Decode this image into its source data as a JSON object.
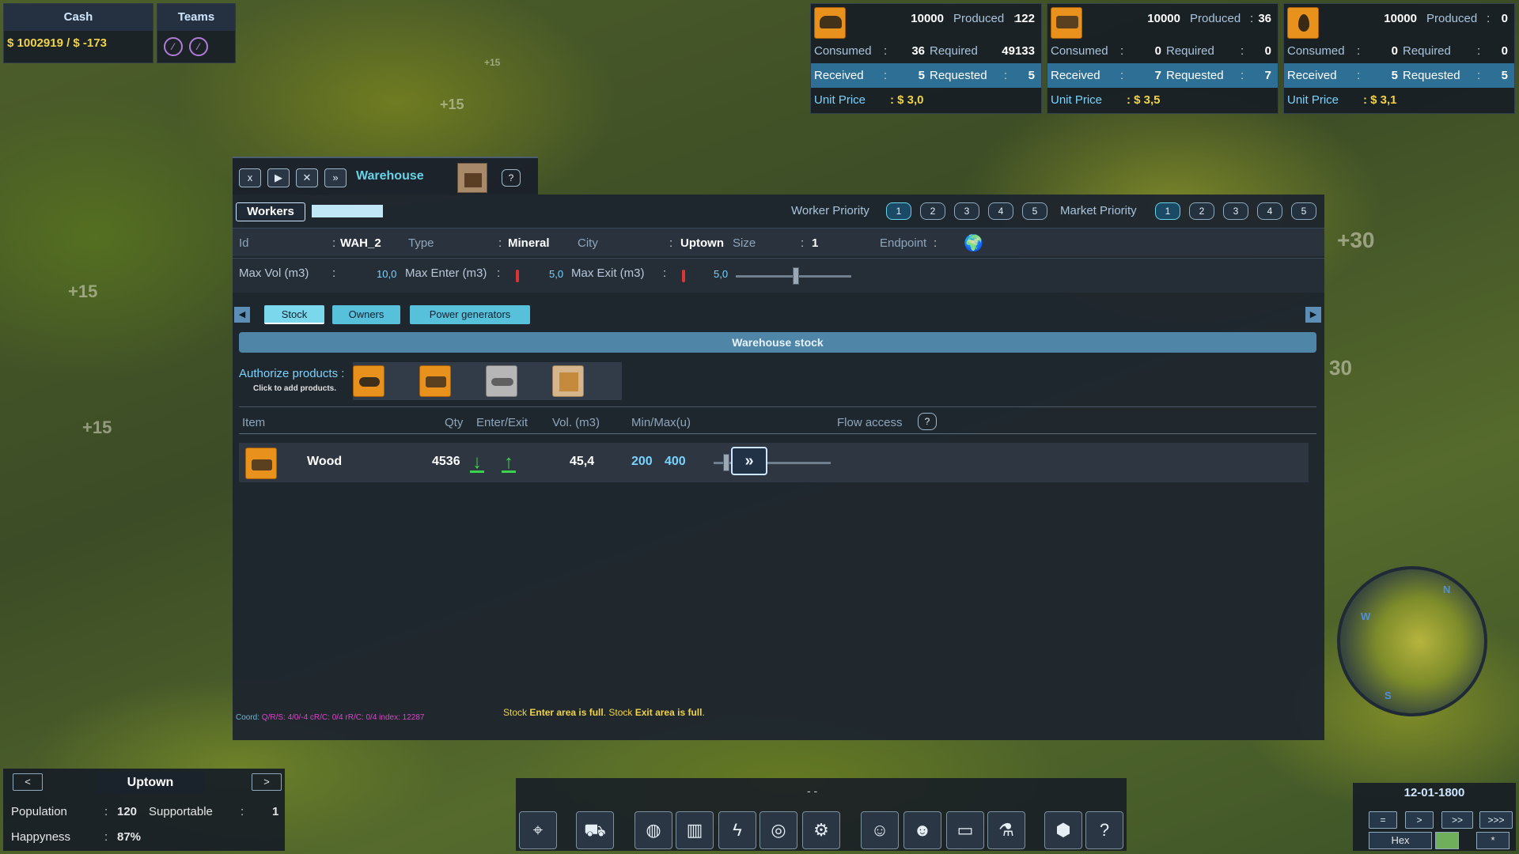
{
  "top_left": {
    "cash_label": "Cash",
    "cash_value": "$ 1002919  /  $ -173",
    "teams_label": "Teams"
  },
  "resources": [
    {
      "icon": "tools-icon",
      "amount": "10000",
      "produced_label": "Produced",
      "produced": "122",
      "consumed_label": "Consumed",
      "consumed": "36",
      "required_label": "Required",
      "required": "49133",
      "received_label": "Received",
      "received": "5",
      "requested_label": "Requested",
      "requested": "5",
      "unit_price_label": "Unit Price",
      "unit_price": ": $ 3,0"
    },
    {
      "icon": "wood-icon",
      "amount": "10000",
      "produced_label": "Produced",
      "produced": "36",
      "consumed_label": "Consumed",
      "consumed": "0",
      "required_label": "Required",
      "required": "0",
      "received_label": "Received",
      "received": "7",
      "requested_label": "Requested",
      "requested": "7",
      "unit_price_label": "Unit Price",
      "unit_price": ": $ 3,5"
    },
    {
      "icon": "oil-drop-icon",
      "amount": "10000",
      "produced_label": "Produced",
      "produced": "0",
      "consumed_label": "Consumed",
      "consumed": "0",
      "required_label": "Required",
      "required": "0",
      "received_label": "Received",
      "received": "5",
      "requested_label": "Requested",
      "requested": "5",
      "unit_price_label": "Unit Price",
      "unit_price": ": $ 3,1"
    }
  ],
  "window": {
    "title": "Warehouse",
    "close_glyph": "x",
    "play_glyph": "▶",
    "cross_glyph": "✕",
    "ff_glyph": "»",
    "help_glyph": "?"
  },
  "workers": {
    "button_label": "Workers",
    "worker_priority_label": "Worker Priority",
    "market_priority_label": "Market Priority",
    "priorities": [
      "1",
      "2",
      "3",
      "4",
      "5"
    ]
  },
  "info": {
    "id_label": "Id",
    "id_value": "WAH_2",
    "type_label": "Type",
    "type_value": "Mineral",
    "city_label": "City",
    "city_value": "Uptown",
    "size_label": "Size",
    "size_value": "1",
    "endpoint_label": "Endpoint",
    "max_vol_label": "Max Vol (m3)",
    "max_vol_value": "10,0",
    "max_enter_label": "Max Enter (m3)",
    "max_enter_value": "5,0",
    "max_exit_label": "Max Exit (m3)",
    "max_exit_value": "5,0"
  },
  "tabs": [
    "Stock",
    "Owners",
    "Power generators"
  ],
  "stock": {
    "header": "Warehouse stock",
    "authorize_label": "Authorize products :",
    "authorize_hint": "Click to add products.",
    "columns": {
      "item": "Item",
      "qty": "Qty",
      "enter_exit": "Enter/Exit",
      "vol": "Vol. (m3)",
      "minmax": "Min/Max(u)",
      "flow": "Flow access"
    },
    "rows": [
      {
        "item": "Wood",
        "qty": "4536",
        "vol": "45,4",
        "min": "200",
        "max": "400"
      }
    ]
  },
  "footer": {
    "coord_label": "Coord:",
    "coord_value": "Q/R/S: 4/0/-4 cR/C: 0/4 rR/C: 0/4 index: 12287",
    "status_1": "Stock ",
    "status_2": "Enter area is full",
    "status_3": ". Stock ",
    "status_4": "Exit area is full",
    "status_5": "."
  },
  "city": {
    "prev": "<",
    "next": ">",
    "name": "Uptown",
    "population_label": "Population",
    "population": "120",
    "supportable_label": "Supportable",
    "supportable": "1",
    "happiness_label": "Happyness",
    "happiness": "87%"
  },
  "toolbar": {
    "dash": "-  -"
  },
  "minimap": {
    "n": "N",
    "s": "S",
    "w": "W"
  },
  "time": {
    "date": "12-01-1800",
    "speeds": [
      "=",
      ">",
      ">>",
      ">>>"
    ],
    "hex": "Hex",
    "star": "*"
  },
  "world_labels": [
    "+30",
    "30",
    "+15",
    "+15",
    "+15",
    "+15"
  ]
}
